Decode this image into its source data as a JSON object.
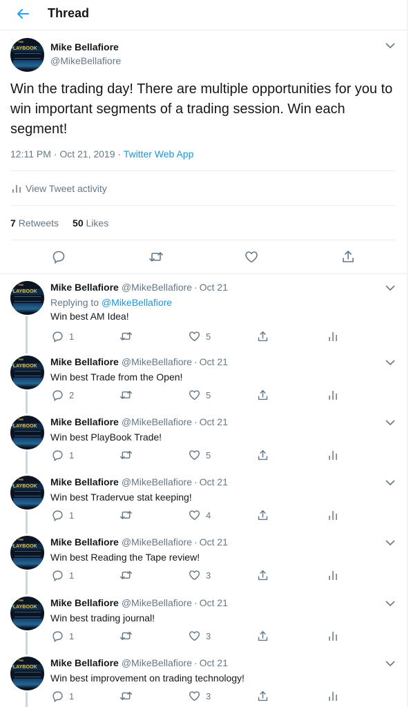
{
  "header": {
    "title": "Thread"
  },
  "avatar": {
    "sub": "THE",
    "title": "PLAYBOOK"
  },
  "main": {
    "name": "Mike Bellafiore",
    "handle": "@MikeBellafiore",
    "text": "Win the trading day!  There are multiple opportunities for you to win important segments of a trading session. Win each segment!",
    "timestamp": "12:11 PM · Oct 21, 2019 · ",
    "app": "Twitter Web App",
    "activity_label": "View Tweet activity",
    "retweets_count": "7",
    "retweets_label": "Retweets",
    "likes_count": "50",
    "likes_label": "Likes"
  },
  "replies": [
    {
      "name": "Mike Bellafiore",
      "handle": "@MikeBellafiore",
      "date": "Oct 21",
      "replying_prefix": "Replying to ",
      "replying_to": "@MikeBellafiore",
      "text": "Win best AM Idea!",
      "reply_count": "1",
      "like_count": "5"
    },
    {
      "name": "Mike Bellafiore",
      "handle": "@MikeBellafiore",
      "date": "Oct 21",
      "text": "Win best Trade from the Open!",
      "reply_count": "2",
      "like_count": "5"
    },
    {
      "name": "Mike Bellafiore",
      "handle": "@MikeBellafiore",
      "date": "Oct 21",
      "text": "Win best PlayBook Trade!",
      "reply_count": "1",
      "like_count": "5"
    },
    {
      "name": "Mike Bellafiore",
      "handle": "@MikeBellafiore",
      "date": "Oct 21",
      "text": "Win best Tradervue stat keeping!",
      "reply_count": "1",
      "like_count": "4"
    },
    {
      "name": "Mike Bellafiore",
      "handle": "@MikeBellafiore",
      "date": "Oct 21",
      "text": "Win best Reading the Tape review!",
      "reply_count": "1",
      "like_count": "3"
    },
    {
      "name": "Mike Bellafiore",
      "handle": "@MikeBellafiore",
      "date": "Oct 21",
      "text": "Win best trading journal!",
      "reply_count": "1",
      "like_count": "3"
    },
    {
      "name": "Mike Bellafiore",
      "handle": "@MikeBellafiore",
      "date": "Oct 21",
      "text": "Win best improvement on trading technology!",
      "reply_count": "1",
      "like_count": "3"
    }
  ],
  "colors": {
    "accent": "#1da1f2",
    "link": "#1b95e0",
    "muted": "#657786",
    "text": "#14171a",
    "divider": "#e6ecf0",
    "thread_line": "#ccd6dd"
  },
  "icons": [
    "back-arrow-icon",
    "chevron-down-icon",
    "reply-icon",
    "retweet-icon",
    "like-icon",
    "share-icon",
    "analytics-icon"
  ]
}
